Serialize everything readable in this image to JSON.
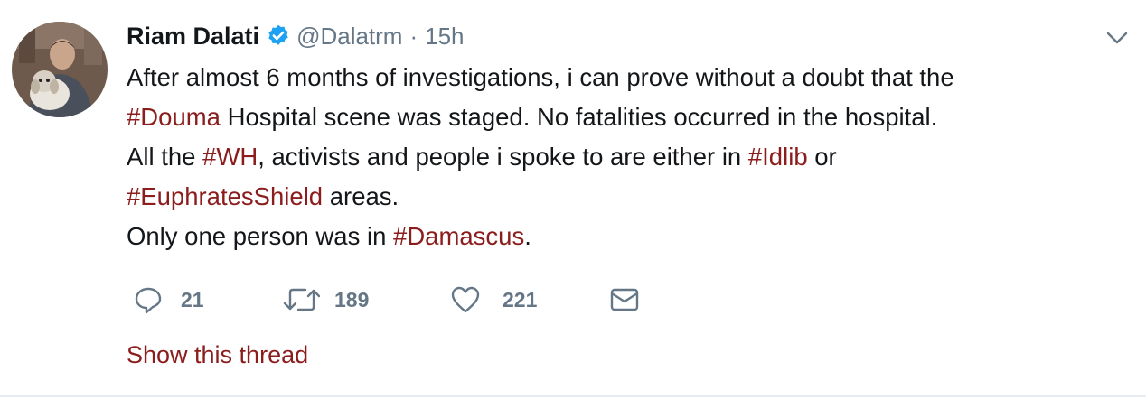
{
  "author": {
    "name": "Riam Dalati",
    "handle": "@Dalatrm",
    "separator": "·",
    "time": "15h",
    "verified": true
  },
  "tweet": {
    "lines": [
      [
        {
          "text": "After almost 6 months of investigations, i can prove without a doubt that the",
          "hashtag": false
        }
      ],
      [
        {
          "text": "#Douma",
          "hashtag": true
        },
        {
          "text": " Hospital scene was staged. No fatalities occurred in the hospital.",
          "hashtag": false
        }
      ],
      [
        {
          "text": "All the ",
          "hashtag": false
        },
        {
          "text": "#WH",
          "hashtag": true
        },
        {
          "text": ", activists and people i spoke to are either in ",
          "hashtag": false
        },
        {
          "text": "#Idlib",
          "hashtag": true
        },
        {
          "text": " or",
          "hashtag": false
        }
      ],
      [
        {
          "text": "#EuphratesShield",
          "hashtag": true
        },
        {
          "text": " areas.",
          "hashtag": false
        }
      ],
      [
        {
          "text": "Only one person was in ",
          "hashtag": false
        },
        {
          "text": "#Damascus",
          "hashtag": true
        },
        {
          "text": ".",
          "hashtag": false
        }
      ]
    ]
  },
  "actions": {
    "replies": "21",
    "retweets": "189",
    "likes": "221"
  },
  "thread_link": "Show this thread",
  "colors": {
    "hashtag": "#8b1d1d",
    "muted": "#657786",
    "verified": "#1da1f2",
    "text": "#14171a"
  },
  "icons": {
    "reply": "reply-icon",
    "retweet": "retweet-icon",
    "like": "heart-icon",
    "dm": "envelope-icon",
    "menu": "chevron-down-icon",
    "verified": "verified-badge-icon"
  }
}
